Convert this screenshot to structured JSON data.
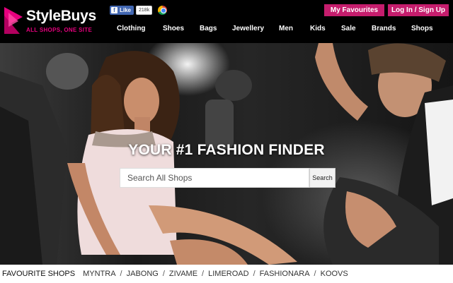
{
  "header": {
    "logo": {
      "name": "StyleBuys",
      "tagline": "ALL SHOPS, ONE SITE"
    },
    "social": {
      "like_label": "Like",
      "like_count": "218k"
    },
    "buttons": {
      "favourites": "My Favourites",
      "login": "Log In / Sign Up"
    },
    "nav": [
      {
        "label": "Clothing"
      },
      {
        "label": "Shoes"
      },
      {
        "label": "Bags"
      },
      {
        "label": "Jewellery"
      },
      {
        "label": "Men"
      },
      {
        "label": "Kids"
      },
      {
        "label": "Sale"
      },
      {
        "label": "Brands"
      },
      {
        "label": "Shops"
      }
    ]
  },
  "hero": {
    "title": "YOUR #1 FASHION FINDER",
    "search": {
      "placeholder": "Search All Shops",
      "value": "",
      "button": "Search"
    }
  },
  "favourite_shops": {
    "label": "FAVOURITE SHOPS",
    "shops": [
      "MYNTRA",
      "JABONG",
      "ZIVAME",
      "LIMEROAD",
      "FASHIONARA",
      "KOOVS"
    ]
  },
  "colors": {
    "accent": "#c51d6d",
    "header_bg": "#000000",
    "brand_pink": "#e6007e",
    "facebook": "#4267b2"
  }
}
